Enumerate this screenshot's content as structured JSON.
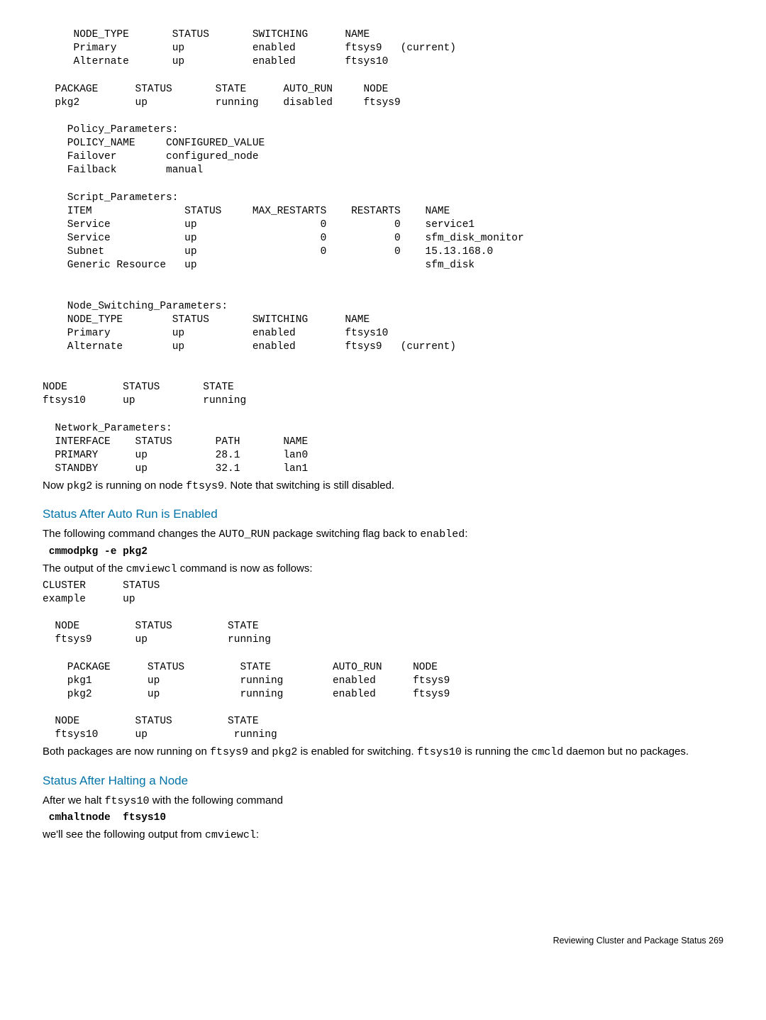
{
  "block1": "     NODE_TYPE       STATUS       SWITCHING      NAME\n     Primary         up           enabled        ftsys9   (current)\n     Alternate       up           enabled        ftsys10\n\n  PACKAGE      STATUS       STATE      AUTO_RUN     NODE\n  pkg2         up           running    disabled     ftsys9\n\n    Policy_Parameters:\n    POLICY_NAME     CONFIGURED_VALUE\n    Failover        configured_node\n    Failback        manual\n\n    Script_Parameters:\n    ITEM               STATUS     MAX_RESTARTS    RESTARTS    NAME\n    Service            up                    0           0    service1\n    Service            up                    0           0    sfm_disk_monitor\n    Subnet             up                    0           0    15.13.168.0\n    Generic Resource   up                                     sfm_disk\n\n\n    Node_Switching_Parameters:\n    NODE_TYPE        STATUS       SWITCHING      NAME\n    Primary          up           enabled        ftsys10\n    Alternate        up           enabled        ftsys9   (current)\n\n\nNODE         STATUS       STATE\nftsys10      up           running\n\n  Network_Parameters:\n  INTERFACE    STATUS       PATH       NAME\n  PRIMARY      up           28.1       lan0\n  STANDBY      up           32.1       lan1",
  "after_block1_a": "Now ",
  "after_block1_b": "pkg2",
  "after_block1_c": " is running on node ",
  "after_block1_d": "ftsys9",
  "after_block1_e": ". Note that switching is still disabled.",
  "sect1_heading": "Status After Auto Run is Enabled",
  "sect1_p1_a": "The following command changes the ",
  "sect1_p1_b": "AUTO_RUN",
  "sect1_p1_c": " package switching flag back to ",
  "sect1_p1_d": "enabled",
  "sect1_p1_e": ":",
  "cmd1": " cmmodpkg -e pkg2",
  "sect1_p2_a": "The output of the ",
  "sect1_p2_b": "cmviewcl",
  "sect1_p2_c": " command is now as follows:",
  "block2": "CLUSTER      STATUS\nexample      up\n\n  NODE         STATUS         STATE\n  ftsys9       up             running\n\n    PACKAGE      STATUS         STATE          AUTO_RUN     NODE\n    pkg1         up             running        enabled      ftsys9\n    pkg2         up             running        enabled      ftsys9\n\n  NODE         STATUS         STATE\n  ftsys10      up              running",
  "after_block2_a": "Both packages are now running on ",
  "after_block2_b": "ftsys9",
  "after_block2_c": " and ",
  "after_block2_d": "pkg2",
  "after_block2_e": " is enabled for switching. ",
  "after_block2_f": "ftsys10",
  "after_block2_g": " is running the ",
  "after_block2_h": "cmcld",
  "after_block2_i": " daemon but no packages.",
  "sect2_heading": "Status After Halting a Node",
  "sect2_p1_a": "After we halt ",
  "sect2_p1_b": "ftsys10",
  "sect2_p1_c": " with the following command",
  "cmd2": " cmhaltnode  ftsys10",
  "sect2_p2_a": "we'll see the following output from ",
  "sect2_p2_b": "cmviewcl",
  "sect2_p2_c": ":",
  "footer": "Reviewing Cluster and Package Status   269"
}
